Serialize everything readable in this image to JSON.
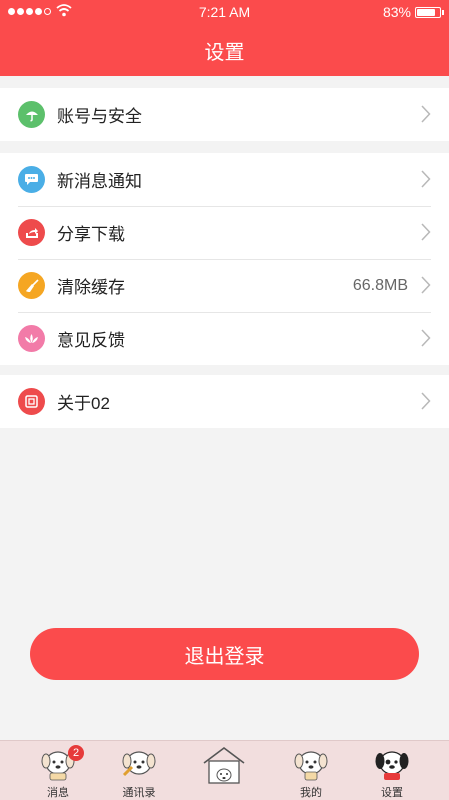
{
  "status_bar": {
    "time": "7:21 AM",
    "battery": "83%",
    "battery_level": 0.83
  },
  "header": {
    "title": "设置"
  },
  "groups": [
    {
      "items": [
        {
          "label": "账号与安全",
          "icon": "umbrella-icon",
          "color": "#5cc06b"
        }
      ]
    },
    {
      "items": [
        {
          "label": "新消息通知",
          "icon": "chat-bubble-icon",
          "color": "#4aaee6"
        },
        {
          "label": "分享下载",
          "icon": "share-icon",
          "color": "#ee4b4c"
        },
        {
          "label": "清除缓存",
          "value": "66.8MB",
          "icon": "broom-icon",
          "color": "#f5a623"
        },
        {
          "label": "意见反馈",
          "icon": "lotus-icon",
          "color": "#f27ba8"
        }
      ]
    },
    {
      "items": [
        {
          "label": "关于02",
          "icon": "info-box-icon",
          "color": "#ee4b4c"
        }
      ]
    }
  ],
  "logout": {
    "label": "退出登录"
  },
  "tabbar": {
    "tabs": [
      {
        "label": "消息",
        "badge": "2"
      },
      {
        "label": "通讯录"
      },
      {
        "label": ""
      },
      {
        "label": "我的"
      },
      {
        "label": "设置"
      }
    ]
  },
  "colors": {
    "accent": "#fb4b4c",
    "background": "#f3f3f3",
    "tabbar": "#f2dede"
  }
}
